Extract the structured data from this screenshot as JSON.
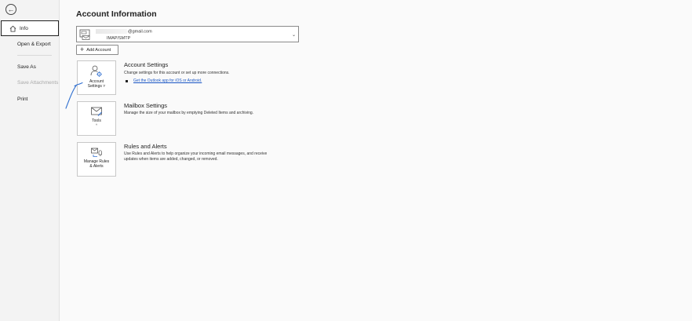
{
  "nav": {
    "back_label": "Back",
    "items": [
      {
        "label": "Info",
        "selected": true
      },
      {
        "label": "Open & Export",
        "selected": false
      },
      {
        "label": "Save As",
        "selected": false
      },
      {
        "label": "Save Attachments",
        "selected": false,
        "disabled": true
      },
      {
        "label": "Print",
        "selected": false
      }
    ]
  },
  "main": {
    "title": "Account Information",
    "account": {
      "email": "@gmail.com",
      "type": "IMAP/SMTP"
    },
    "add_account_label": "Add Account",
    "sections": [
      {
        "tile_label_line1": "Account",
        "tile_label_line2": "Settings",
        "title": "Account Settings",
        "description": "Change settings for this account or set up more connections.",
        "link_text": "Get the Outlook app for iOS or Android."
      },
      {
        "tile_label_line1": "Tools",
        "title": "Mailbox Settings",
        "description": "Manage the size of your mailbox by emptying Deleted Items and archiving."
      },
      {
        "tile_label_line1": "Manage Rules",
        "tile_label_line2": "& Alerts",
        "title": "Rules and Alerts",
        "description_line1": "Use Rules and Alerts to help organize your incoming email messages, and receive",
        "description_line2": "updates when items are added, changed, or removed."
      }
    ]
  },
  "colors": {
    "nav_bg": "#f3f3f3",
    "link": "#1a56c4",
    "pen": "#2f6fd0"
  }
}
